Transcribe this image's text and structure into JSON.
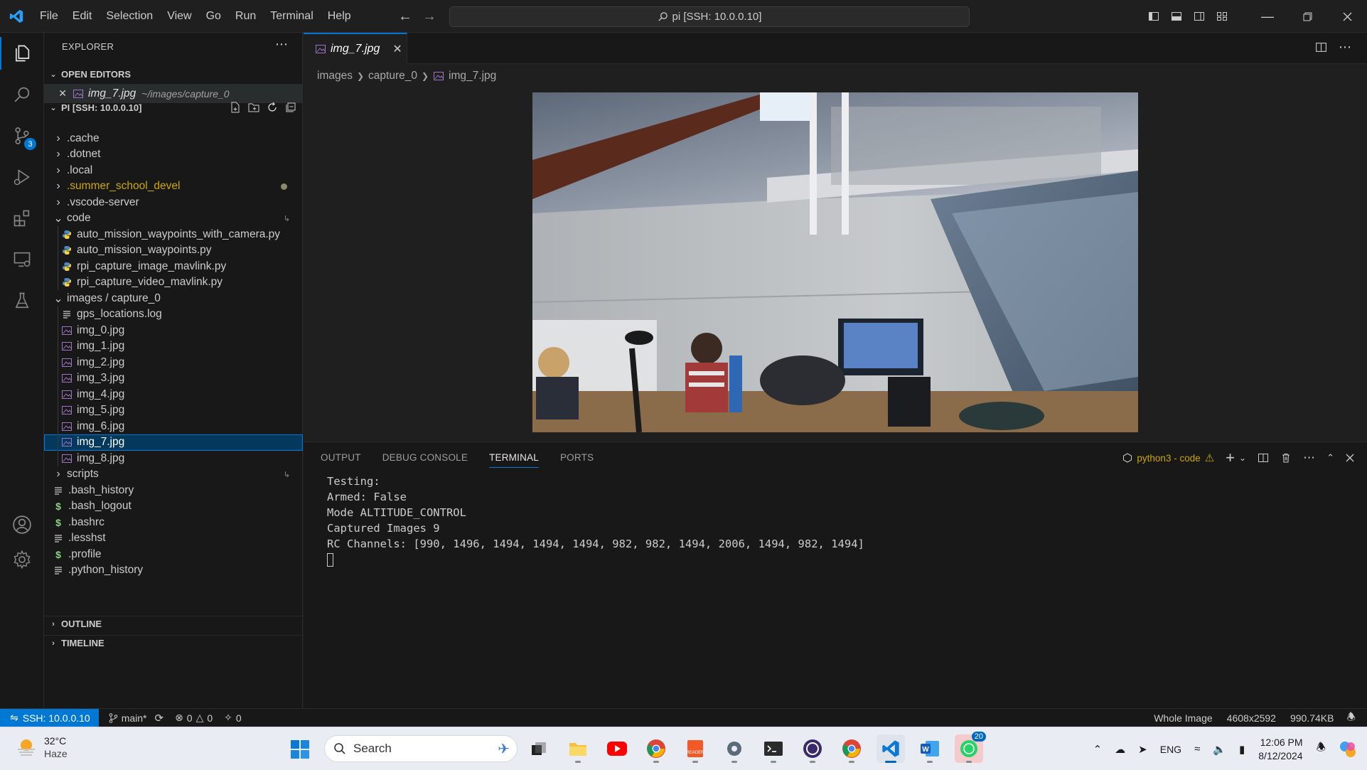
{
  "menu": [
    "File",
    "Edit",
    "Selection",
    "View",
    "Go",
    "Run",
    "Terminal",
    "Help"
  ],
  "command_center": "pi [SSH: 10.0.0.10]",
  "activity_badge": "3",
  "sidebar": {
    "title": "EXPLORER",
    "open_editors_label": "OPEN EDITORS",
    "open_editor": {
      "name": "img_7.jpg",
      "path": "~/images/capture_0"
    },
    "workspace_label": "PI [SSH: 10.0.0.10]",
    "items": [
      {
        "label": ".cache",
        "kind": "folder"
      },
      {
        "label": ".dotnet",
        "kind": "folder"
      },
      {
        "label": ".local",
        "kind": "folder"
      },
      {
        "label": ".summer_school_devel",
        "kind": "folder",
        "color": "#cca700"
      },
      {
        "label": ".vscode-server",
        "kind": "folder"
      },
      {
        "label": "code",
        "kind": "folder-open"
      },
      {
        "label": "auto_mission_waypoints_with_camera.py",
        "kind": "py"
      },
      {
        "label": "auto_mission_waypoints.py",
        "kind": "py"
      },
      {
        "label": "rpi_capture_image_mavlink.py",
        "kind": "py"
      },
      {
        "label": "rpi_capture_video_mavlink.py",
        "kind": "py"
      },
      {
        "label": "images / capture_0",
        "kind": "folder-open"
      },
      {
        "label": "gps_locations.log",
        "kind": "txt"
      },
      {
        "label": "img_0.jpg",
        "kind": "img"
      },
      {
        "label": "img_1.jpg",
        "kind": "img"
      },
      {
        "label": "img_2.jpg",
        "kind": "img"
      },
      {
        "label": "img_3.jpg",
        "kind": "img"
      },
      {
        "label": "img_4.jpg",
        "kind": "img"
      },
      {
        "label": "img_5.jpg",
        "kind": "img"
      },
      {
        "label": "img_6.jpg",
        "kind": "img"
      },
      {
        "label": "img_7.jpg",
        "kind": "img"
      },
      {
        "label": "img_8.jpg",
        "kind": "img"
      },
      {
        "label": "scripts",
        "kind": "folder"
      },
      {
        "label": ".bash_history",
        "kind": "txt"
      },
      {
        "label": ".bash_logout",
        "kind": "sh"
      },
      {
        "label": ".bashrc",
        "kind": "sh"
      },
      {
        "label": ".lesshst",
        "kind": "txt"
      },
      {
        "label": ".profile",
        "kind": "sh"
      },
      {
        "label": ".python_history",
        "kind": "txt"
      }
    ],
    "outline_label": "OUTLINE",
    "timeline_label": "TIMELINE"
  },
  "editor": {
    "tab_label": "img_7.jpg",
    "breadcrumb": [
      "images",
      "capture_0",
      "img_7.jpg"
    ]
  },
  "panel": {
    "tabs": [
      "OUTPUT",
      "DEBUG CONSOLE",
      "TERMINAL",
      "PORTS"
    ],
    "terminal_name": "python3 - code",
    "terminal_lines": [
      "Testing:",
      "Armed: False",
      "Mode ALTITUDE_CONTROL",
      "Captured Images 9",
      "RC Channels: [990, 1496, 1494, 1494, 1494, 982, 982, 1494, 2006, 1494, 982, 1494]"
    ]
  },
  "statusbar": {
    "remote": "SSH: 10.0.0.10",
    "branch": "main*",
    "errors": "0",
    "warnings": "0",
    "ports": "0",
    "zoom": "Whole Image",
    "dimensions": "4608x2592",
    "filesize": "990.74KB"
  },
  "taskbar": {
    "temp": "32°C",
    "condition": "Haze",
    "search_placeholder": "Search",
    "whatsapp_badge": "20",
    "lang": "ENG",
    "time": "12:06 PM",
    "date": "8/12/2024"
  },
  "colors": {
    "accent": "#0078d4",
    "selection": "#04395e",
    "warning": "#cca700",
    "python_icon": "#4b8bbe",
    "image_icon": "#a074c4"
  }
}
